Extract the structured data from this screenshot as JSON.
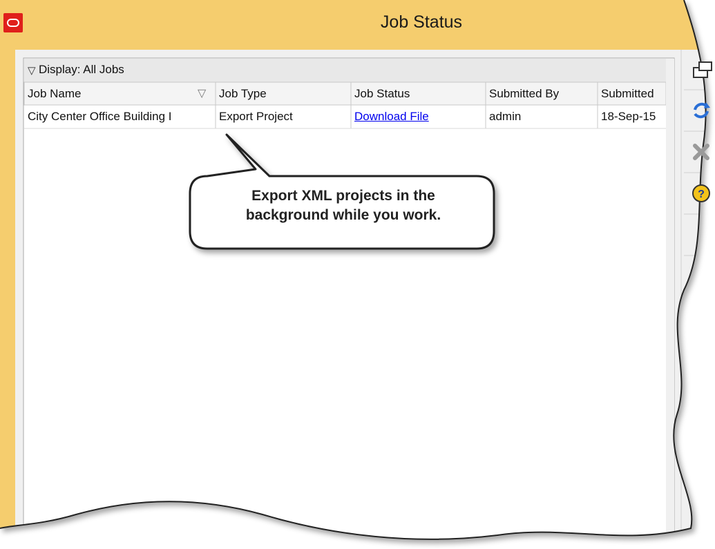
{
  "window": {
    "title": "Job Status"
  },
  "filter": {
    "display_label": "Display: All Jobs"
  },
  "table": {
    "columns": [
      "Job Name",
      "Job Type",
      "Job Status",
      "Submitted By",
      "Submitted"
    ],
    "rows": [
      {
        "job_name": "City Center Office Building I",
        "job_type": "Export Project",
        "job_status": "Download File",
        "submitted_by": "admin",
        "submitted": "18-Sep-15"
      }
    ]
  },
  "callout": {
    "line1": "Export XML projects in the",
    "line2": "background while you work."
  },
  "toolbar": {
    "icons": [
      "export-icon",
      "refresh-icon",
      "delete-icon",
      "help-icon"
    ]
  },
  "colors": {
    "title_bar": "#f5cd6e",
    "link": "#0000ee",
    "app_icon": "#e0201b"
  }
}
